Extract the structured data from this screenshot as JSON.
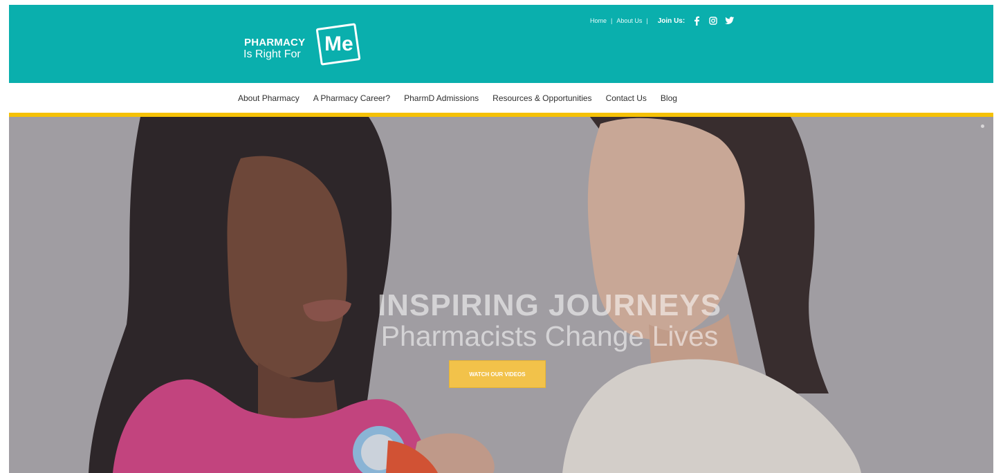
{
  "brand": {
    "line1": "PHARMACY",
    "line2": "Is Right For",
    "mark": "Me"
  },
  "toplinks": {
    "home": "Home",
    "sep1": "|",
    "about": "About Us",
    "sep2": "|",
    "join_label": "Join Us:",
    "social": [
      {
        "icon": "facebook-icon",
        "glyph": "f"
      },
      {
        "icon": "instagram-icon",
        "glyph": "◎"
      },
      {
        "icon": "twitter-icon",
        "glyph": "🐦"
      }
    ]
  },
  "nav": {
    "items": [
      "About Pharmacy",
      "A Pharmacy Career?",
      "PharmD Admissions",
      "Resources & Opportunities",
      "Contact Us",
      "Blog"
    ]
  },
  "hero": {
    "title": "INSPIRING JOURNEYS",
    "subtitle": "Pharmacists Change Lives",
    "cta": "WATCH OUR VIDEOS"
  },
  "colors": {
    "header_teal": "#0aafad",
    "accent_yellow": "#f5c106",
    "cta_yellow": "#f2c24a"
  }
}
